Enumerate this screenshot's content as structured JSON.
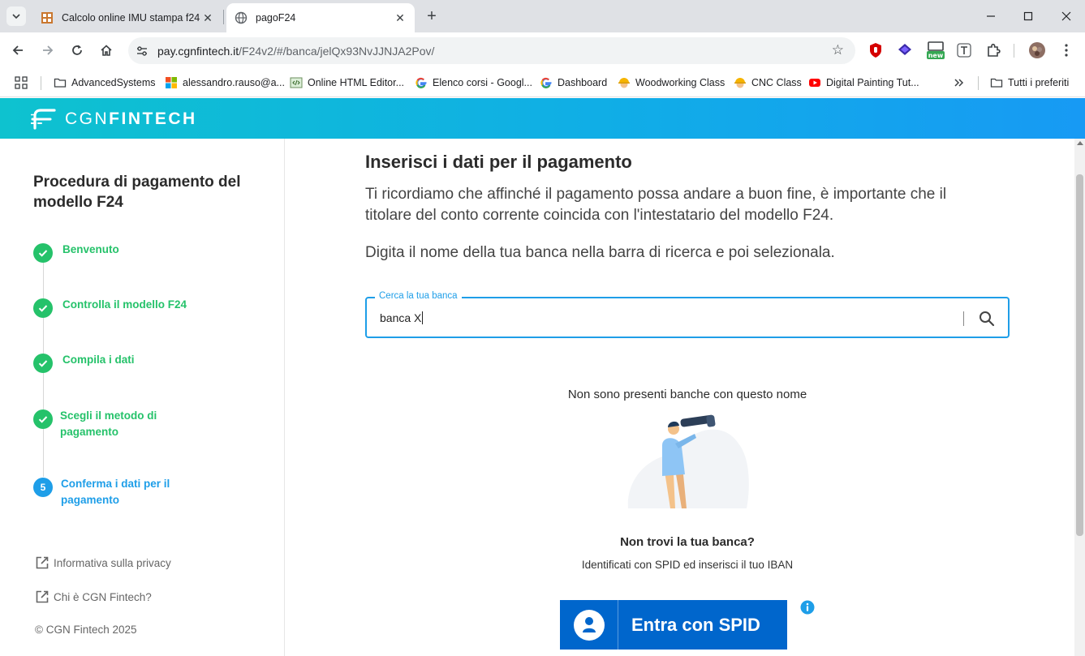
{
  "browser": {
    "tabs": [
      {
        "title": "Calcolo online IMU stampa f24",
        "active": false
      },
      {
        "title": "pagoF24",
        "active": true
      }
    ],
    "address": {
      "domain": "pay.cgnfintech.it",
      "path": "/F24v2/#/banca/jelQx93NvJJNJA2Pov/"
    },
    "extension_badge": "new",
    "bookmarks": [
      {
        "label": "AdvancedSystems",
        "icon": "folder-icon"
      },
      {
        "label": "alessandro.rauso@a...",
        "icon": "microsoft-icon"
      },
      {
        "label": "Online HTML Editor...",
        "icon": "code-editor-icon"
      },
      {
        "label": "Elenco corsi - Googl...",
        "icon": "google-icon"
      },
      {
        "label": "Dashboard",
        "icon": "google-icon"
      },
      {
        "label": "Woodworking Class",
        "icon": "helmet-icon"
      },
      {
        "label": "CNC Class",
        "icon": "helmet-icon"
      },
      {
        "label": "Digital Painting Tut...",
        "icon": "youtube-icon"
      }
    ],
    "all_bookmarks_label": "Tutti i preferiti"
  },
  "header": {
    "brand_light": "CGN",
    "brand_bold": "FINTECH"
  },
  "sidebar": {
    "title": "Procedura di pagamento del modello F24",
    "steps": [
      {
        "label": "Benvenuto",
        "state": "done"
      },
      {
        "label": "Controlla il modello F24",
        "state": "done"
      },
      {
        "label": "Compila i dati",
        "state": "done"
      },
      {
        "label": "Scegli il metodo di pagamento",
        "state": "done"
      },
      {
        "label": "Conferma i dati per il pagamento",
        "state": "current",
        "number": "5"
      }
    ],
    "links": [
      {
        "label": "Informativa sulla privacy"
      },
      {
        "label": "Chi è CGN Fintech?"
      }
    ],
    "copyright": "© CGN Fintech 2025"
  },
  "main": {
    "title": "Inserisci i dati per il pagamento",
    "intro": "Ti ricordiamo che affinché il pagamento possa andare a buon fine, è importante che il titolare del conto corrente coincida con l'intestatario del modello F24.",
    "hint": "Digita il nome della tua banca nella barra di ricerca e poi selezionala.",
    "search": {
      "label": "Cerca la tua banca",
      "value": "banca X"
    },
    "empty_message": "Non sono presenti banche con questo nome",
    "not_found_title": "Non trovi la tua banca?",
    "not_found_subtitle": "Identificati con SPID ed inserisci il tuo IBAN",
    "spid_button": "Entra con SPID"
  },
  "colors": {
    "accent": "#1e9ee8",
    "success": "#25c26a",
    "spid": "#0066cc"
  }
}
